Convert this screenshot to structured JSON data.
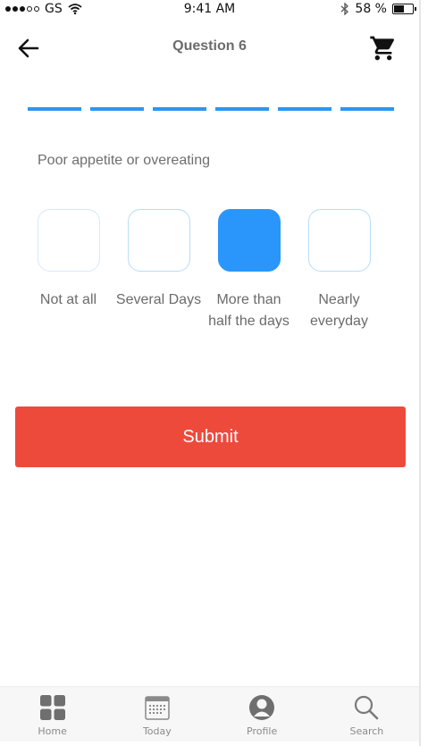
{
  "status": {
    "carrier": "GS",
    "time": "9:41 AM",
    "battery": "58 %",
    "battery_level": 0.58
  },
  "header": {
    "title": "Question 6"
  },
  "progress": {
    "segments": 6
  },
  "question": {
    "text": "Poor appetite or overeating"
  },
  "options": [
    {
      "label": "Not at all",
      "selected": false
    },
    {
      "label": "Several Days",
      "selected": false
    },
    {
      "label": "More than half the days",
      "selected": true
    },
    {
      "label": "Nearly everyday",
      "selected": false
    }
  ],
  "submit": {
    "label": "Submit",
    "color": "#ed4a3c"
  },
  "accent": "#2a96fb",
  "tabs": [
    {
      "label": "Home",
      "icon": "grid-icon"
    },
    {
      "label": "Today",
      "icon": "calendar-icon"
    },
    {
      "label": "Profile",
      "icon": "profile-icon"
    },
    {
      "label": "Search",
      "icon": "search-icon"
    }
  ]
}
